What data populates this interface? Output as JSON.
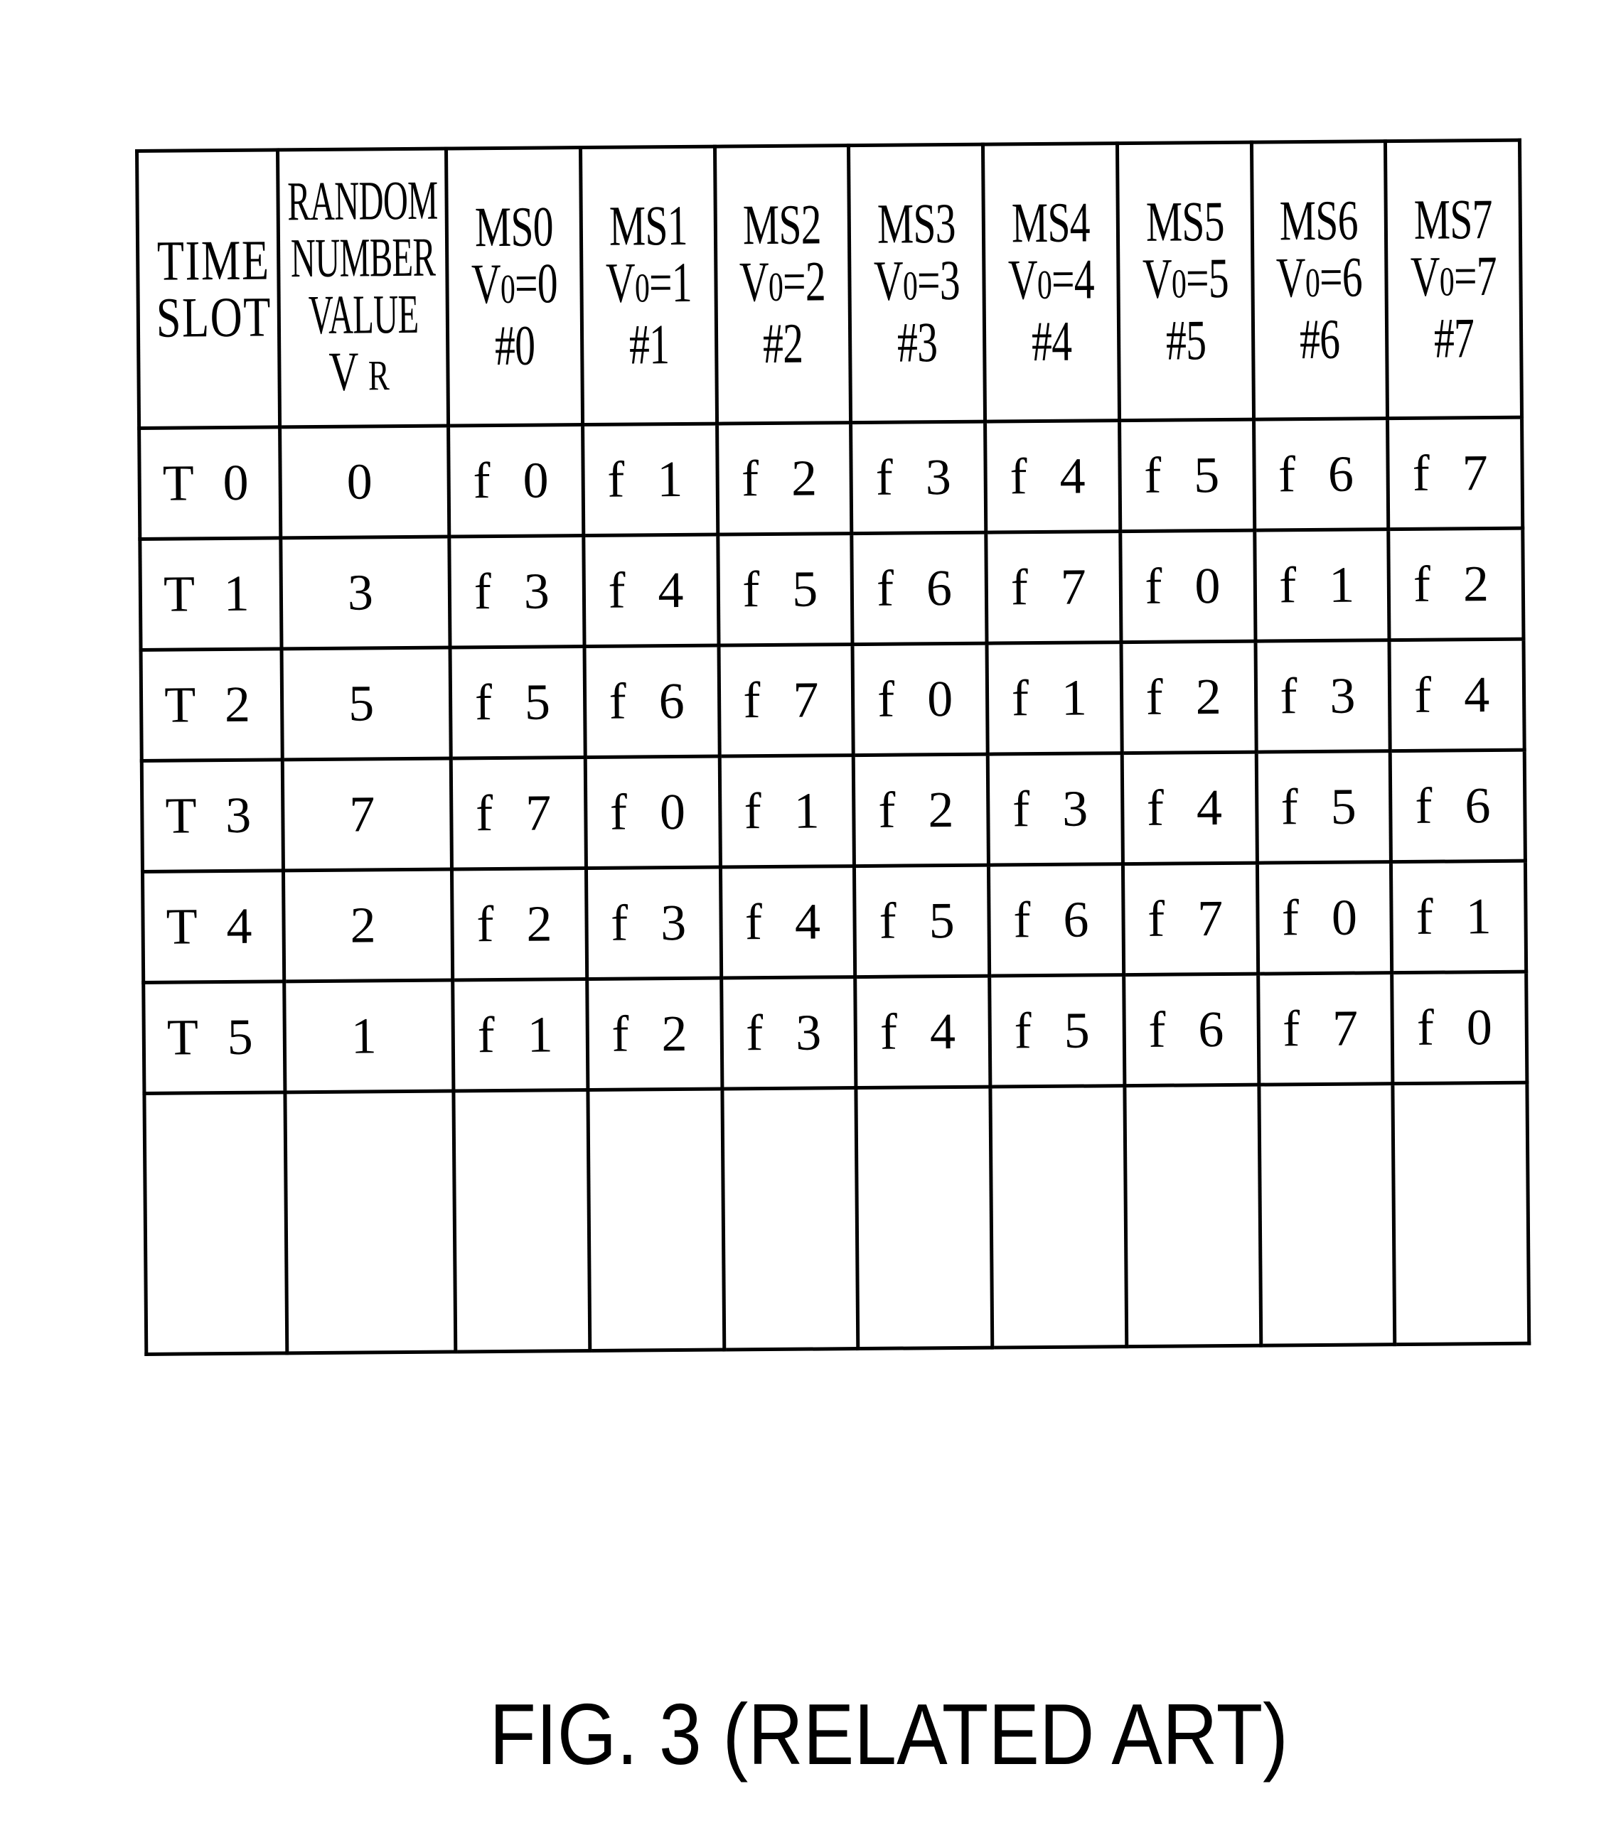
{
  "figure": {
    "caption": "FIG. 3 (RELATED ART)",
    "table": {
      "header": {
        "time_slot": [
          "TIME",
          "SLOT"
        ],
        "random_number": [
          "RANDOM",
          "NUMBER",
          "VALUE"
        ],
        "random_symbol": {
          "main": "V",
          "sub": "R"
        },
        "stations": [
          {
            "name": "MS0",
            "offset_label": "V",
            "offset_sub": "0",
            "offset_value": "=0",
            "index": "#0"
          },
          {
            "name": "MS1",
            "offset_label": "V",
            "offset_sub": "0",
            "offset_value": "=1",
            "index": "#1"
          },
          {
            "name": "MS2",
            "offset_label": "V",
            "offset_sub": "0",
            "offset_value": "=2",
            "index": "#2"
          },
          {
            "name": "MS3",
            "offset_label": "V",
            "offset_sub": "0",
            "offset_value": "=3",
            "index": "#3"
          },
          {
            "name": "MS4",
            "offset_label": "V",
            "offset_sub": "0",
            "offset_value": "=4",
            "index": "#4"
          },
          {
            "name": "MS5",
            "offset_label": "V",
            "offset_sub": "0",
            "offset_value": "=5",
            "index": "#5"
          },
          {
            "name": "MS6",
            "offset_label": "V",
            "offset_sub": "0",
            "offset_value": "=6",
            "index": "#6"
          },
          {
            "name": "MS7",
            "offset_label": "V",
            "offset_sub": "0",
            "offset_value": "=7",
            "index": "#7"
          }
        ]
      },
      "rows": [
        {
          "slot": "T0",
          "vr": "0",
          "freqs": [
            "f0",
            "f1",
            "f2",
            "f3",
            "f4",
            "f5",
            "f6",
            "f7"
          ]
        },
        {
          "slot": "T1",
          "vr": "3",
          "freqs": [
            "f3",
            "f4",
            "f5",
            "f6",
            "f7",
            "f0",
            "f1",
            "f2"
          ]
        },
        {
          "slot": "T2",
          "vr": "5",
          "freqs": [
            "f5",
            "f6",
            "f7",
            "f0",
            "f1",
            "f2",
            "f3",
            "f4"
          ]
        },
        {
          "slot": "T3",
          "vr": "7",
          "freqs": [
            "f7",
            "f0",
            "f1",
            "f2",
            "f3",
            "f4",
            "f5",
            "f6"
          ]
        },
        {
          "slot": "T4",
          "vr": "2",
          "freqs": [
            "f2",
            "f3",
            "f4",
            "f5",
            "f6",
            "f7",
            "f0",
            "f1"
          ]
        },
        {
          "slot": "T5",
          "vr": "1",
          "freqs": [
            "f1",
            "f2",
            "f3",
            "f4",
            "f5",
            "f6",
            "f7",
            "f0"
          ]
        }
      ],
      "blank_rows": 1
    }
  }
}
